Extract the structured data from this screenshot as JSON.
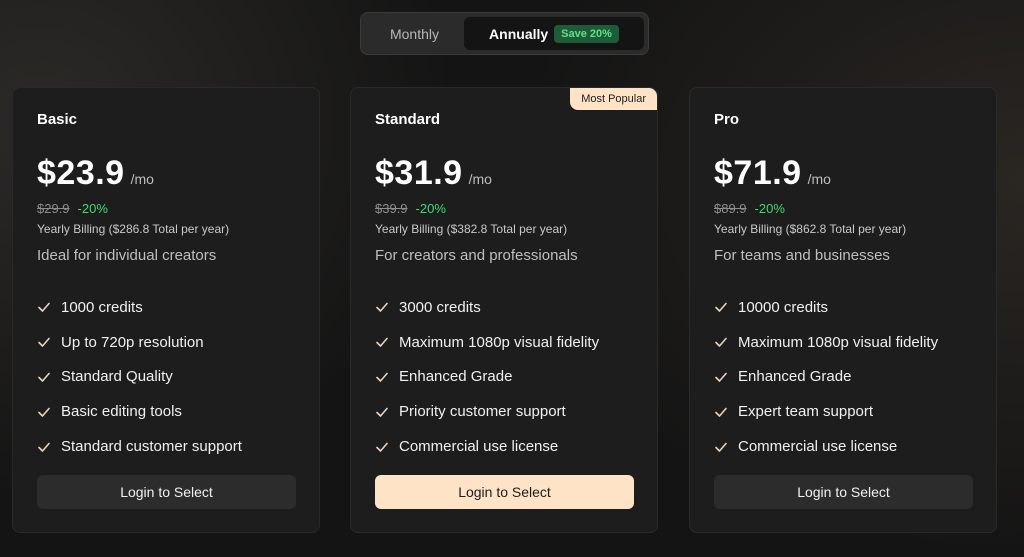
{
  "billing_toggle": {
    "monthly_label": "Monthly",
    "annually_label": "Annually",
    "save_badge": "Save 20%",
    "selected": "annually"
  },
  "colors": {
    "accent_cream": "#ffe3c7",
    "discount_green": "#3ddc6f",
    "card_bg": "#1d1d1d",
    "page_bg": "#141414"
  },
  "plans": [
    {
      "name": "Basic",
      "price": "$23.9",
      "per": "/mo",
      "original_price": "$29.9",
      "discount": "-20%",
      "yearly_billing": "Yearly Billing ($286.8 Total per year)",
      "description": "Ideal for individual creators",
      "features": [
        "1000 credits",
        "Up to 720p resolution",
        "Standard Quality",
        "Basic editing tools",
        "Standard customer support"
      ],
      "cta": "Login to Select",
      "feature_icon": "check-icon"
    },
    {
      "name": "Standard",
      "badge": "Most Popular",
      "price": "$31.9",
      "per": "/mo",
      "original_price": "$39.9",
      "discount": "-20%",
      "yearly_billing": "Yearly Billing ($382.8 Total per year)",
      "description": "For creators and professionals",
      "features": [
        "3000 credits",
        "Maximum 1080p visual fidelity",
        "Enhanced Grade",
        "Priority customer support",
        "Commercial use license"
      ],
      "cta": "Login to Select",
      "feature_icon": "check-icon"
    },
    {
      "name": "Pro",
      "price": "$71.9",
      "per": "/mo",
      "original_price": "$89.9",
      "discount": "-20%",
      "yearly_billing": "Yearly Billing ($862.8 Total per year)",
      "description": "For teams and businesses",
      "features": [
        "10000 credits",
        "Maximum 1080p visual fidelity",
        "Enhanced Grade",
        "Expert team support",
        "Commercial use license"
      ],
      "cta": "Login to Select",
      "feature_icon": "check-icon"
    }
  ]
}
